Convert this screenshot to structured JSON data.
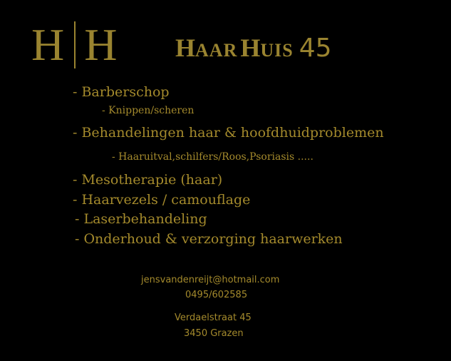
{
  "logo": {
    "left_letter": "H",
    "right_letter": "H"
  },
  "brand": {
    "h1": "H",
    "aar": "AAR",
    "h2": "H",
    "uis": "UIS",
    "number": "45"
  },
  "services": {
    "barberschop": "- Barberschop",
    "knippen": "- Knippen/scheren",
    "behandelingen": "- Behandelingen haar & hoofdhuidproblemen",
    "haaruitval": "- Haaruitval,schilfers/Roos,Psoriasis .....",
    "mesotherapie": "- Mesotherapie (haar)",
    "haarvezels": "- Haarvezels / camouflage",
    "laser": "- Laserbehandeling",
    "onderhoud": "- Onderhoud & verzorging haarwerken"
  },
  "contact": {
    "email": "jensvandenreijt@hotmail.com",
    "phone": "0495/602585",
    "street": "Verdaelstraat 45",
    "city": "3450 Grazen"
  },
  "colors": {
    "background": "#000000",
    "gold": "#a48a2c"
  }
}
